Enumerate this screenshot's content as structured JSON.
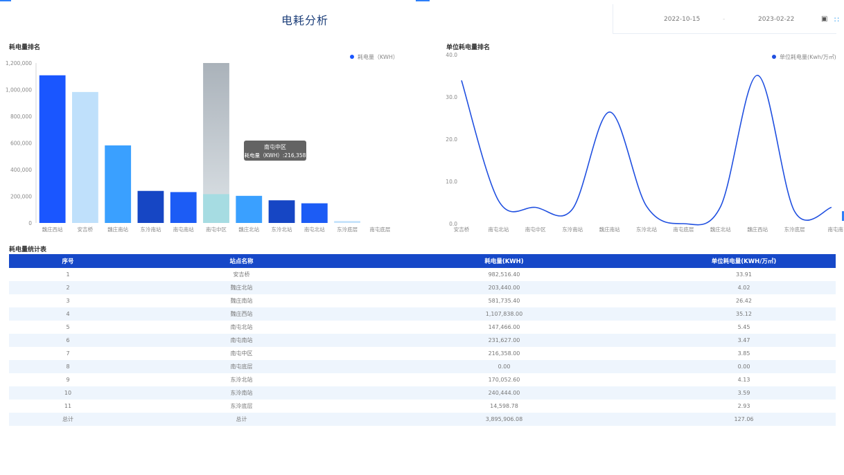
{
  "page": {
    "title": "电耗分析"
  },
  "date_range": {
    "start": "2022-10-15",
    "separator": "-",
    "end": "2023-02-22",
    "calendar_icon": "calendar-icon",
    "edge_icon": "dotted-bracket-icon"
  },
  "colors": {
    "header_blue": "#1648c8",
    "line_blue": "#1f4fe0",
    "tooltip_bg": "#5b5b5b"
  },
  "left_panel": {
    "title": "耗电量排名",
    "tooltip": {
      "title": "南屯中区",
      "text": "耗电量（KWH）:216,358"
    }
  },
  "right_panel": {
    "title": "单位耗电量排名"
  },
  "chart_data": [
    {
      "type": "bar",
      "title": "耗电量排名",
      "categories": [
        "魏庄西站",
        "安吉桥",
        "魏庄南站",
        "东泠南站",
        "南屯南站",
        "南屯中区",
        "魏庄北站",
        "东泠北站",
        "南屯北站",
        "东泠底层",
        "南屯底层"
      ],
      "series": [
        {
          "name": "耗电量（KWH）",
          "values": [
            1107838,
            982516,
            581735,
            240444,
            231627,
            216358,
            203440,
            170052,
            147466,
            14598,
            0
          ]
        }
      ],
      "bar_colors": [
        "#1a56ff",
        "#bfe0fb",
        "#3aa0ff",
        "#1646c4",
        "#1c5cf5",
        "#a6dce2",
        "#3aa0ff",
        "#1646c4",
        "#1c5cf5",
        "#c5e2fb",
        "#c5e2fb"
      ],
      "ylim": [
        0,
        1200000
      ],
      "y_ticks": [
        "0",
        "200,000",
        "400,000",
        "600,000",
        "800,000",
        "1,000,000",
        "1,200,000"
      ],
      "legend": "top-right",
      "highlighted": "南屯中区"
    },
    {
      "type": "line",
      "title": "单位耗电量排名",
      "x": [
        "安吉桥",
        "南屯北站",
        "南屯中区",
        "东泠南站",
        "魏庄南站",
        "东泠北站",
        "南屯底层",
        "魏庄北站",
        "魏庄西站",
        "东泠底层",
        "南屯南"
      ],
      "series": [
        {
          "name": "单位耗电量(Kwh/万㎡)",
          "values": [
            33.91,
            5.45,
            3.85,
            3.47,
            26.42,
            4.13,
            0.0,
            4.02,
            35.12,
            2.93,
            3.85
          ]
        }
      ],
      "ylim": [
        0,
        40
      ],
      "y_ticks": [
        "0.0",
        "10.0",
        "20.0",
        "30.0",
        "40.0"
      ],
      "legend": "top-right"
    }
  ],
  "table": {
    "title": "耗电量统计表",
    "columns": [
      "序号",
      "站点名称",
      "耗电量(KWH)",
      "单位耗电量(KWH/万㎡)"
    ],
    "rows": [
      [
        "1",
        "安吉桥",
        "982,516.40",
        "33.91"
      ],
      [
        "2",
        "魏庄北站",
        "203,440.00",
        "4.02"
      ],
      [
        "3",
        "魏庄南站",
        "581,735.40",
        "26.42"
      ],
      [
        "4",
        "魏庄西站",
        "1,107,838.00",
        "35.12"
      ],
      [
        "5",
        "南屯北站",
        "147,466.00",
        "5.45"
      ],
      [
        "6",
        "南屯南站",
        "231,627.00",
        "3.47"
      ],
      [
        "7",
        "南屯中区",
        "216,358.00",
        "3.85"
      ],
      [
        "8",
        "南屯底层",
        "0.00",
        "0.00"
      ],
      [
        "9",
        "东泠北站",
        "170,052.60",
        "4.13"
      ],
      [
        "10",
        "东泠南站",
        "240,444.00",
        "3.59"
      ],
      [
        "11",
        "东泠底层",
        "14,598.78",
        "2.93"
      ],
      [
        "总计",
        "总计",
        "3,895,906.08",
        "127.06"
      ]
    ]
  }
}
